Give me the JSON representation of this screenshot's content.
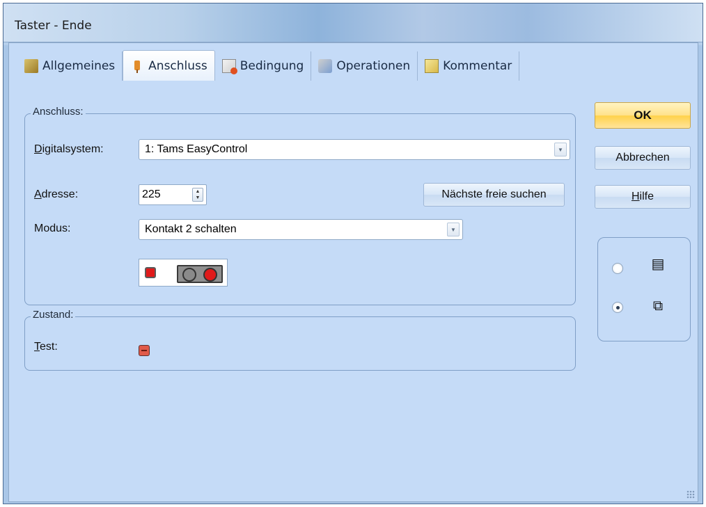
{
  "window": {
    "title": "Taster - Ende"
  },
  "tabs": [
    {
      "label": "Allgemeines",
      "icon": "general-icon"
    },
    {
      "label": "Anschluss",
      "icon": "plug-icon",
      "active": true
    },
    {
      "label": "Bedingung",
      "icon": "condition-icon"
    },
    {
      "label": "Operationen",
      "icon": "operations-icon"
    },
    {
      "label": "Kommentar",
      "icon": "comment-icon"
    }
  ],
  "anschluss": {
    "legend": "Anschluss:",
    "digitalsystem_label_prefix": "D",
    "digitalsystem_label_rest": "igitalsystem:",
    "digitalsystem_value": "1: Tams EasyControl",
    "adresse_label_prefix": "A",
    "adresse_label_rest": "dresse:",
    "adresse_value": "225",
    "next_free_button": "Nächste freie suchen",
    "modus_label": "Modus:",
    "modus_value": "Kontakt 2 schalten"
  },
  "zustand": {
    "legend": "Zustand:",
    "test_label_prefix": "T",
    "test_label_rest": "est:"
  },
  "buttons": {
    "ok": "OK",
    "cancel": "Abbrechen",
    "help_prefix": "H",
    "help_rest": "ilfe"
  },
  "view_options": [
    {
      "icon": "list-view-icon",
      "checked": false
    },
    {
      "icon": "copy-view-icon",
      "checked": true
    }
  ],
  "colors": {
    "client_bg": "#c5dbf7",
    "ok_button": "#ffd24a",
    "indicator_red": "#e01a1a"
  }
}
